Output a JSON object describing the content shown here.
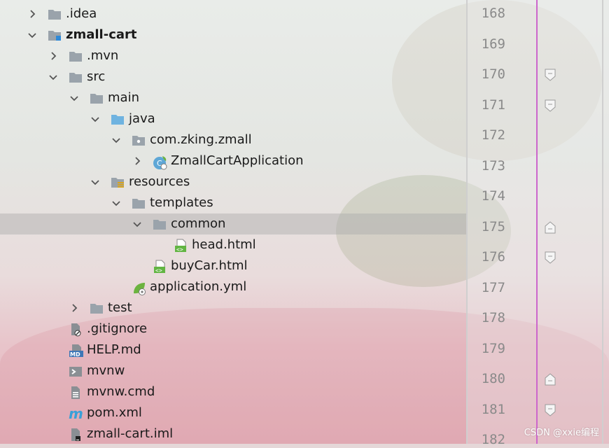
{
  "tree": [
    {
      "label": ".idea",
      "indent": 0,
      "chevron": "right",
      "icon": "folder-icon",
      "bold": false
    },
    {
      "label": "zmall-cart",
      "indent": 0,
      "chevron": "down",
      "icon": "module-folder-icon",
      "bold": true
    },
    {
      "label": ".mvn",
      "indent": 1,
      "chevron": "right",
      "icon": "folder-icon",
      "bold": false
    },
    {
      "label": "src",
      "indent": 1,
      "chevron": "down",
      "icon": "folder-icon",
      "bold": false
    },
    {
      "label": "main",
      "indent": 2,
      "chevron": "down",
      "icon": "folder-icon",
      "bold": false
    },
    {
      "label": "java",
      "indent": 3,
      "chevron": "down",
      "icon": "source-folder-icon",
      "bold": false
    },
    {
      "label": "com.zking.zmall",
      "indent": 4,
      "chevron": "down",
      "icon": "package-icon",
      "bold": false
    },
    {
      "label": "ZmallCartApplication",
      "indent": 5,
      "chevron": "right",
      "icon": "spring-class-icon",
      "bold": false
    },
    {
      "label": "resources",
      "indent": 3,
      "chevron": "down",
      "icon": "resources-folder-icon",
      "bold": false
    },
    {
      "label": "templates",
      "indent": 4,
      "chevron": "down",
      "icon": "folder-icon",
      "bold": false
    },
    {
      "label": "common",
      "indent": 5,
      "chevron": "down",
      "icon": "folder-icon",
      "bold": false,
      "selected": true
    },
    {
      "label": "head.html",
      "indent": 6,
      "chevron": "none",
      "icon": "html-file-icon",
      "bold": false
    },
    {
      "label": "buyCar.html",
      "indent": 5,
      "chevron": "none",
      "icon": "html-file-icon",
      "bold": false
    },
    {
      "label": "application.yml",
      "indent": 4,
      "chevron": "none",
      "icon": "spring-yml-icon",
      "bold": false
    },
    {
      "label": "test",
      "indent": 2,
      "chevron": "right",
      "icon": "folder-icon",
      "bold": false
    },
    {
      "label": ".gitignore",
      "indent": 1,
      "chevron": "none",
      "icon": "gitignore-file-icon",
      "bold": false
    },
    {
      "label": "HELP.md",
      "indent": 1,
      "chevron": "none",
      "icon": "markdown-file-icon",
      "bold": false
    },
    {
      "label": "mvnw",
      "indent": 1,
      "chevron": "none",
      "icon": "shell-file-icon",
      "bold": false
    },
    {
      "label": "mvnw.cmd",
      "indent": 1,
      "chevron": "none",
      "icon": "text-file-icon",
      "bold": false
    },
    {
      "label": "pom.xml",
      "indent": 1,
      "chevron": "none",
      "icon": "maven-file-icon",
      "bold": false
    },
    {
      "label": "zmall-cart.iml",
      "indent": 1,
      "chevron": "none",
      "icon": "iml-file-icon",
      "bold": false
    }
  ],
  "gutter": {
    "line_numbers": [
      "168",
      "169",
      "170",
      "171",
      "172",
      "173",
      "174",
      "175",
      "176",
      "177",
      "178",
      "179",
      "180",
      "181",
      "182"
    ],
    "fold_markers": [
      {
        "line": "170",
        "kind": "fold-start"
      },
      {
        "line": "171",
        "kind": "fold-start"
      },
      {
        "line": "175",
        "kind": "fold-end"
      },
      {
        "line": "176",
        "kind": "fold-start"
      },
      {
        "line": "180",
        "kind": "fold-end"
      },
      {
        "line": "181",
        "kind": "fold-start"
      }
    ]
  },
  "colors": {
    "folder": "#9aa3ab",
    "source_folder": "#6fb3e0",
    "selection": "#aaaaaa",
    "margin_line": "#cc66cc",
    "html_icon": "#62b543",
    "maven_icon": "#3aa0d8"
  },
  "watermark": "CSDN @xxie编程"
}
